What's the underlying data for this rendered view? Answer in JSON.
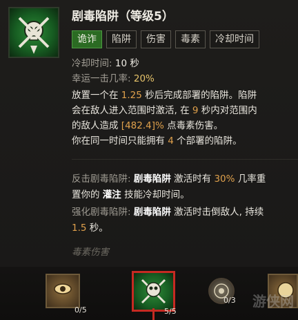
{
  "tooltip": {
    "title": "剧毒陷阱（等级5）",
    "tags": [
      "诡诈",
      "陷阱",
      "伤害",
      "毒素",
      "冷却时间"
    ],
    "active_tag_index": 0,
    "stats": [
      {
        "label": "冷却时间:",
        "value": "10 秒"
      },
      {
        "label": "幸运一击几率:",
        "value": "20%"
      }
    ],
    "desc": {
      "l1a": "放置一个在 ",
      "l1b": "1.25",
      "l1c": " 秒后完成部署的陷阱。陷阱",
      "l2a": "会在敌人进入范围时激活, 在 ",
      "l2b": "9",
      "l2c": " 秒内对范围内",
      "l3a": "的敌人造成 ",
      "l3b": "[482.4]%",
      "l3c": " 点毒素伤害。",
      "l4a": "你在同一时间只能拥有 ",
      "l4b": "4",
      "l4c": " 个部署的陷阱。"
    },
    "enh1": {
      "label": "反击剧毒陷阱:",
      "name": "剧毒陷阱",
      "t1": " 激活时有 ",
      "pct": "30%",
      "t2": " 几率重",
      "l2a": "置你的 ",
      "l2b": "灌注",
      "l2c": " 技能冷却时间。"
    },
    "enh2": {
      "label": "强化剧毒陷阱:",
      "name": "剧毒陷阱",
      "t1": " 激活时击倒敌人, 持续",
      "l2a": "1.5",
      "l2b": " 秒。"
    },
    "footer": "毒素伤害"
  },
  "skill_bar": {
    "slots": [
      {
        "count": "0/5"
      },
      {
        "count": "5/5"
      },
      {
        "count": "0/3"
      }
    ]
  },
  "watermark": "游侠网"
}
